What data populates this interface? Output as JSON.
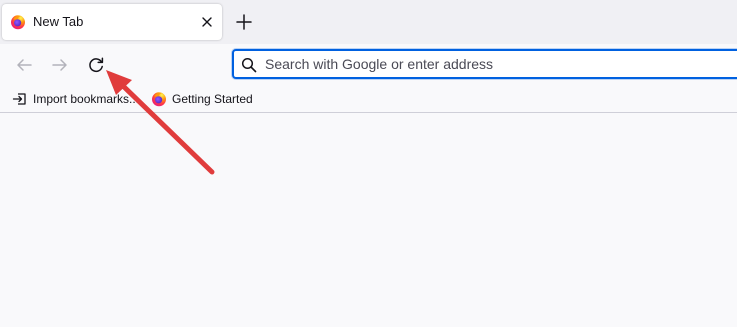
{
  "tabs": [
    {
      "title": "New Tab",
      "favicon": "firefox-logo",
      "active": true
    }
  ],
  "tab_close_icon": "close-icon",
  "new_tab_icon": "plus-icon",
  "nav": {
    "back_icon": "back-arrow-icon",
    "forward_icon": "forward-arrow-icon",
    "reload_icon": "reload-icon"
  },
  "urlbar": {
    "placeholder": "Search with Google or enter address",
    "value": "",
    "icon": "search-icon"
  },
  "bookmarks": [
    {
      "label": "Import bookmarks...",
      "icon": "import-icon"
    },
    {
      "label": "Getting Started",
      "icon": "firefox-logo"
    }
  ],
  "annotation": {
    "type": "arrow",
    "color": "#e03c3c",
    "points_to": "reload-button"
  },
  "colors": {
    "accent": "#0061e0",
    "tabstrip": "#f0f0f4",
    "toolbar": "#f9f9fb",
    "annotation": "#e03c3c"
  }
}
